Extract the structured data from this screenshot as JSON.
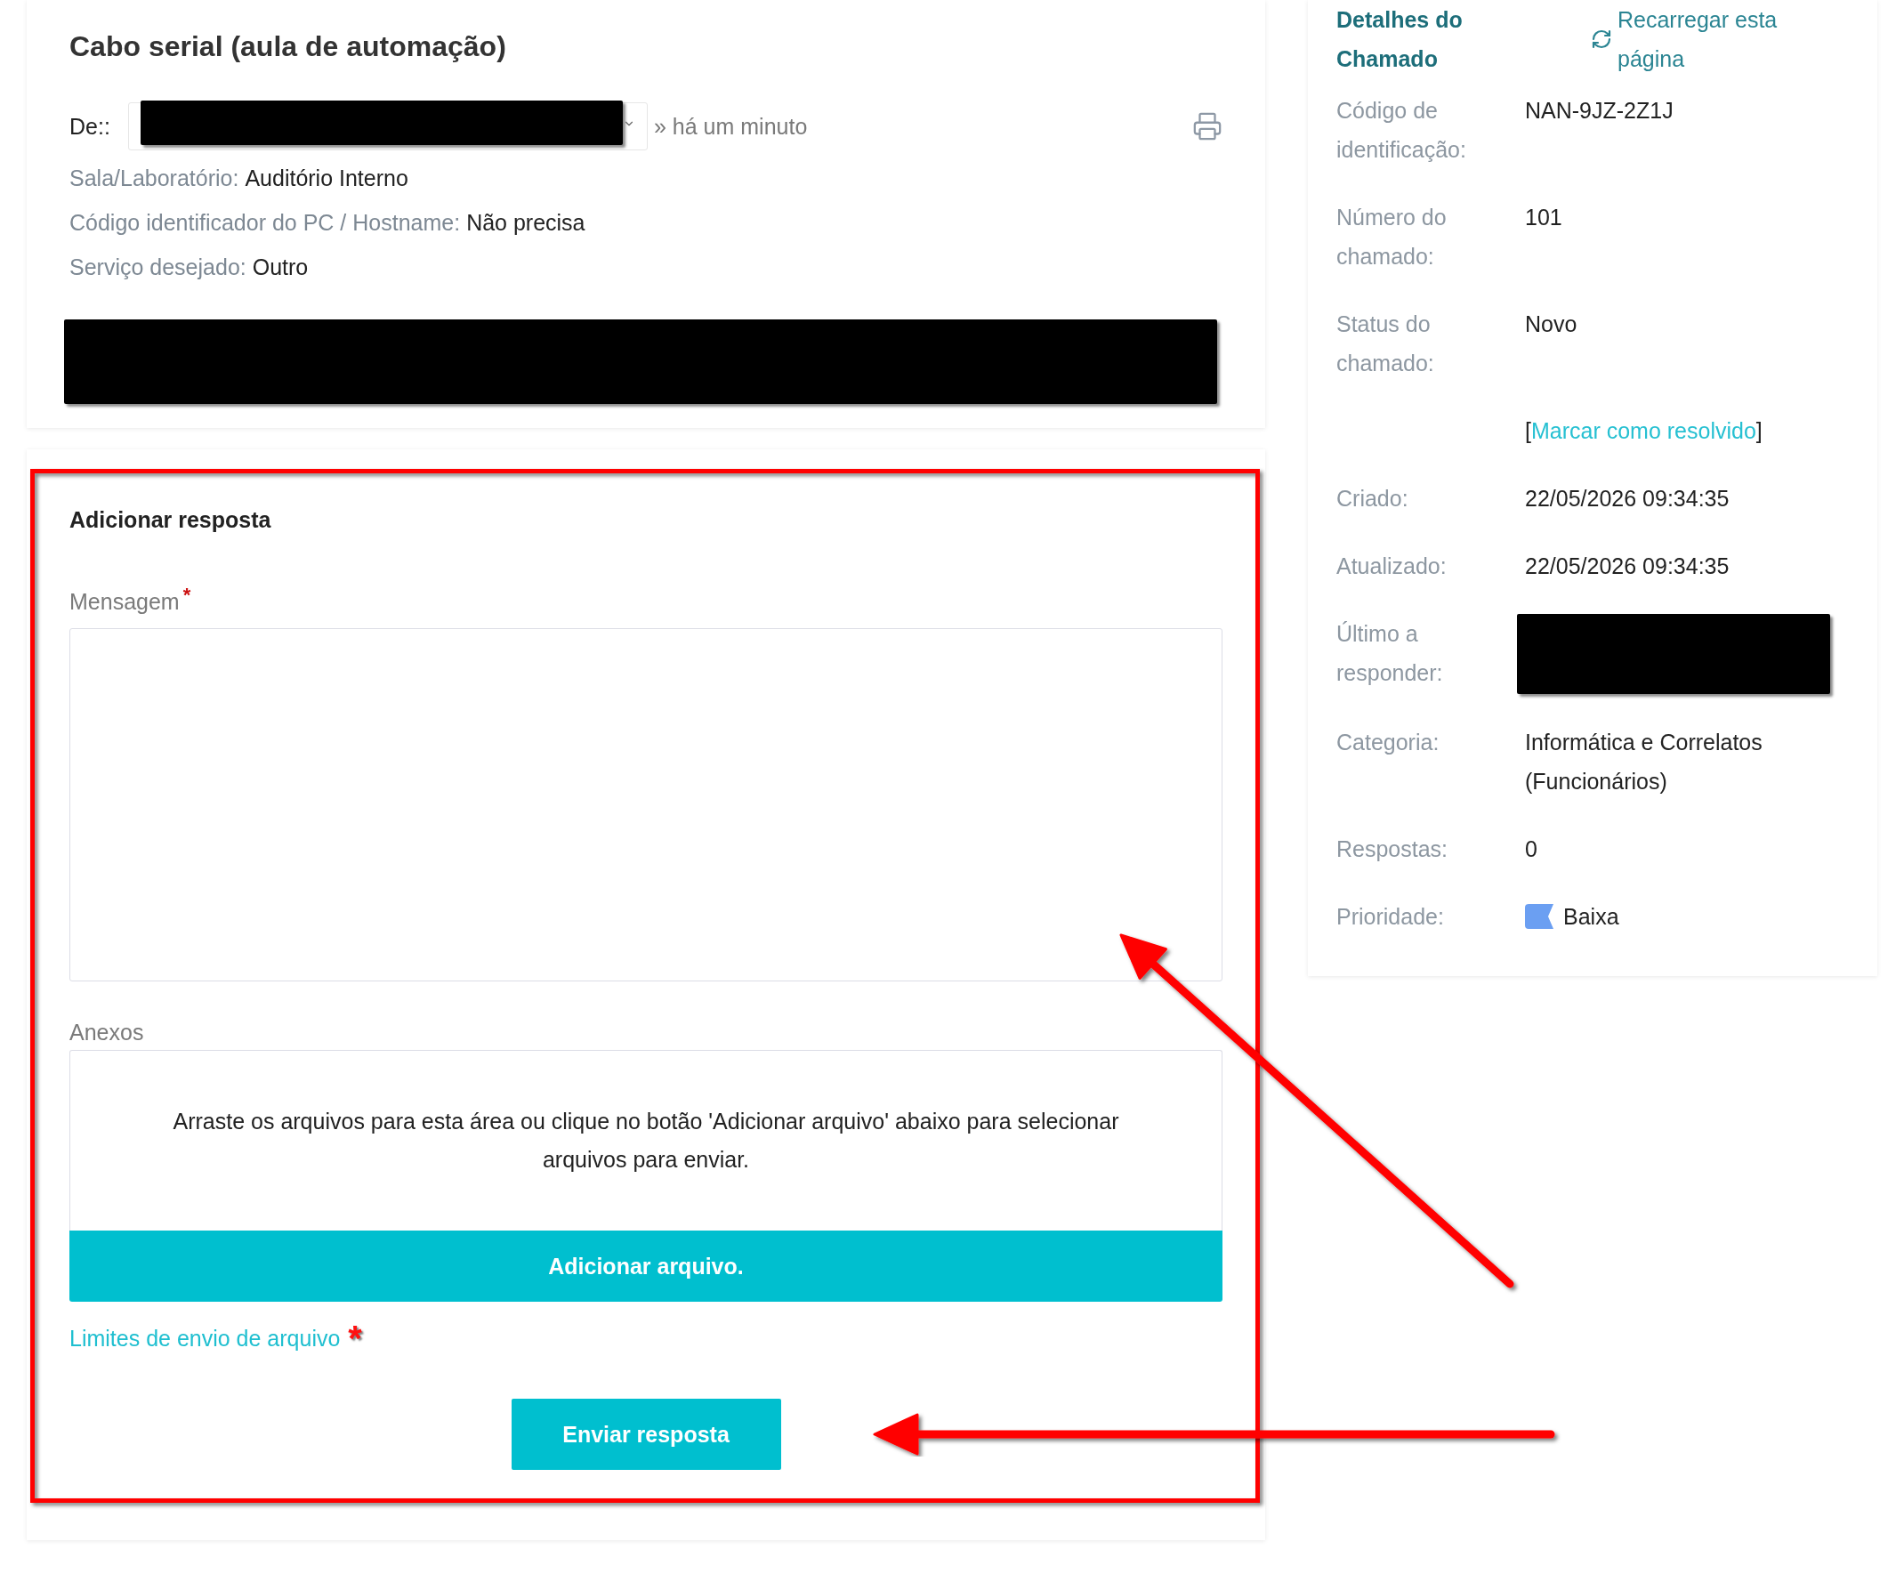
{
  "ticket": {
    "title": "Cabo serial (aula de automação)",
    "from": {
      "label": "De::",
      "redacted": true,
      "time": "» há um minuto"
    },
    "fields": [
      {
        "label": "Sala/Laboratório:",
        "value": "Auditório Interno"
      },
      {
        "label": "Código identificador do PC / Hostname:",
        "value": "Não precisa"
      },
      {
        "label": "Serviço desejado:",
        "value": "Outro"
      }
    ],
    "message": {
      "redacted": true
    }
  },
  "reply_form": {
    "title": "Adicionar resposta",
    "message": {
      "label": "Mensagem",
      "required_mark": "*"
    },
    "attachments": {
      "label": "Anexos",
      "drop_text": "Arraste os arquivos para esta área ou clique no botão 'Adicionar arquivo' abaixo para selecionar arquivos para enviar.",
      "add_button": "Adicionar arquivo."
    },
    "limits_link": {
      "label": "Limites de envio de arquivo",
      "mark": "*"
    },
    "submit_button": "Enviar resposta"
  },
  "details": {
    "title": "Detalhes do Chamado",
    "reload_link": "Recarregar esta página",
    "rows": [
      {
        "kind": "text",
        "label": "Código de identificação:",
        "value": "NAN-9JZ-2Z1J"
      },
      {
        "kind": "text",
        "label": "Número do chamado:",
        "value": "101"
      },
      {
        "kind": "text",
        "label": "Status do chamado:",
        "value": "Novo"
      },
      {
        "kind": "action",
        "open": "[",
        "link": "Marcar como resolvido",
        "close": "]"
      },
      {
        "kind": "text",
        "label": "Criado:",
        "value": "22/05/2026 09:34:35"
      },
      {
        "kind": "text",
        "label": "Atualizado:",
        "value": "22/05/2026 09:34:35"
      },
      {
        "kind": "redacted",
        "label": "Último a responder:"
      },
      {
        "kind": "text",
        "label": "Categoria:",
        "value": "Informática e Correlatos (Funcionários)"
      },
      {
        "kind": "text",
        "label": "Respostas:",
        "value": "0"
      },
      {
        "kind": "priority",
        "label": "Prioridade:",
        "value": "Baixa",
        "color": "#6b9ff2"
      }
    ]
  }
}
